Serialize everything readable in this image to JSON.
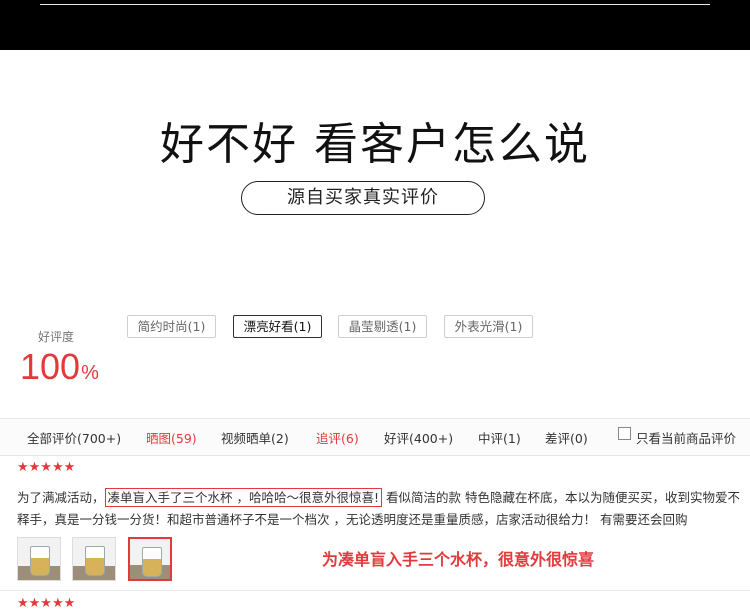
{
  "headline": "好不好 看客户怎么说",
  "source_label": "源自买家真实评价",
  "rating": {
    "label": "好评度",
    "value": "100",
    "unit": "%"
  },
  "tags": [
    {
      "label": "简约时尚(1)",
      "active": false
    },
    {
      "label": "漂亮好看(1)",
      "active": true
    },
    {
      "label": "晶莹剔透(1)",
      "active": false
    },
    {
      "label": "外表光滑(1)",
      "active": false
    }
  ],
  "filters": [
    {
      "label": "全部评价(700+)"
    },
    {
      "label": "晒图(59)"
    },
    {
      "label": "视频晒单(2)"
    },
    {
      "label": "追评(6)"
    },
    {
      "label": "好评(400+)"
    },
    {
      "label": "中评(1)"
    },
    {
      "label": "差评(0)"
    }
  ],
  "only_current_label": "只看当前商品评价",
  "review": {
    "stars": "★★★★★",
    "text_before": "为了满减活动，",
    "text_highlight": "凑单盲入手了三个水杯 ，哈哈哈～很意外很惊喜!",
    "text_after": " 看似简洁的款 特色隐藏在杯底，本以为随便买买，收到实物爱不",
    "text_line2": "释手，真是一分钱一分货！和超市普通杯子不是一个档次 ，无论透明度还是重量质感，店家活动很给力！ 有需要还会回购",
    "callout": "为凑单盲入手三个水杯，很意外很惊喜"
  },
  "next_review_stars": "★★★★★",
  "colors": {
    "accent": "#e4393c",
    "top_bar": "#000000"
  }
}
